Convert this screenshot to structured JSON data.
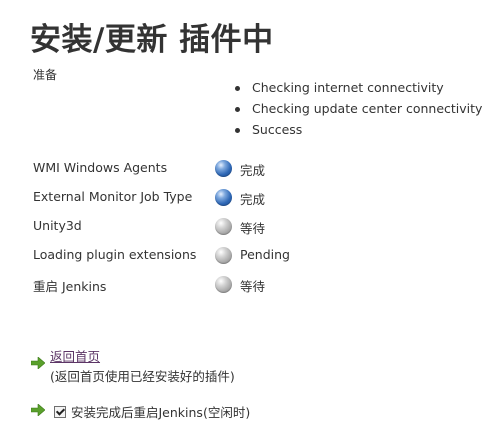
{
  "page": {
    "title": "安装/更新 插件中"
  },
  "preparation": {
    "label": "准备",
    "checks": [
      "Checking internet connectivity",
      "Checking update center connectivity",
      "Success"
    ]
  },
  "plugins": [
    {
      "name": "WMI Windows Agents",
      "status": "完成",
      "state": "blue-ball-icon"
    },
    {
      "name": "External Monitor Job Type",
      "status": "完成",
      "state": "blue-ball-icon"
    },
    {
      "name": "Unity3d",
      "status": "等待",
      "state": "grey-ball-icon"
    },
    {
      "name": "Loading plugin extensions",
      "status": "Pending",
      "state": "grey-ball-icon"
    },
    {
      "name": "重启 Jenkins",
      "status": "等待",
      "state": "grey-ball-icon"
    }
  ],
  "footer": {
    "home_link": "返回首页",
    "home_note": "(返回首页使用已经安装好的插件)",
    "restart_label": "安装完成后重启Jenkins(空闲时)",
    "restart_checked": true
  },
  "colors": {
    "done_ball": "#2e67b5",
    "pending_ball": "#a2a2a2",
    "arrow": "#5aa02c",
    "link": "#5c3566"
  }
}
